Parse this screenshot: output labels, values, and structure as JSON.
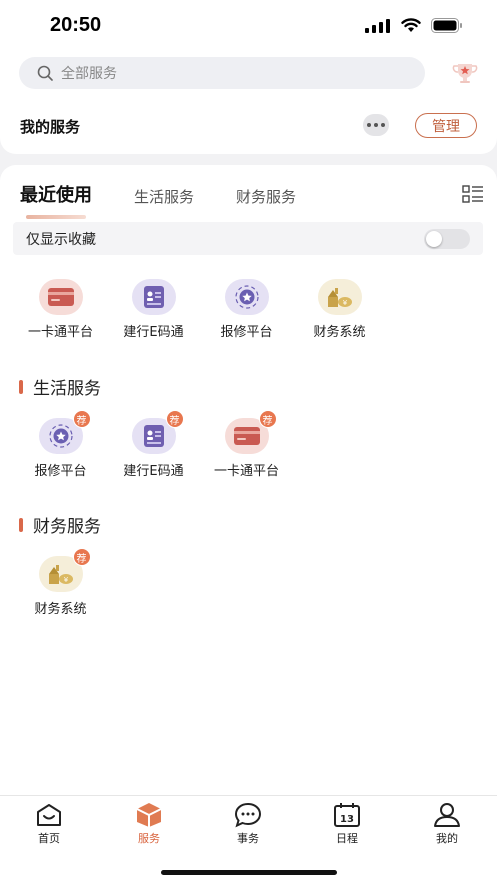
{
  "status": {
    "time": "20:50"
  },
  "search": {
    "placeholder": "全部服务"
  },
  "my_service": {
    "title": "我的服务",
    "manage_label": "管理"
  },
  "tabs": [
    "最近使用",
    "生活服务",
    "财务服务"
  ],
  "favorites": {
    "label": "仅显示收藏",
    "enabled": false
  },
  "recent_apps": [
    {
      "label": "一卡通平台",
      "icon": "card-icon"
    },
    {
      "label": "建行E码通",
      "icon": "id-card-icon"
    },
    {
      "label": "报修平台",
      "icon": "repair-icon"
    },
    {
      "label": "财务系统",
      "icon": "finance-icon"
    }
  ],
  "life_section": {
    "title": "生活服务",
    "badge": "荐",
    "apps": [
      {
        "label": "报修平台",
        "icon": "repair-icon"
      },
      {
        "label": "建行E码通",
        "icon": "id-card-icon"
      },
      {
        "label": "一卡通平台",
        "icon": "card-icon"
      }
    ]
  },
  "finance_section": {
    "title": "财务服务",
    "badge": "荐",
    "apps": [
      {
        "label": "财务系统",
        "icon": "finance-icon"
      }
    ]
  },
  "tabbar": [
    {
      "label": "首页",
      "icon": "home-icon"
    },
    {
      "label": "服务",
      "icon": "service-cube-icon",
      "active": true
    },
    {
      "label": "事务",
      "icon": "chat-icon"
    },
    {
      "label": "日程",
      "icon": "calendar-icon",
      "day": "13"
    },
    {
      "label": "我的",
      "icon": "user-icon"
    }
  ],
  "colors": {
    "accent": "#d8633d",
    "card_red": "#c95a52",
    "id_purple": "#6f5fb0",
    "repair_purple": "#6a5fb2",
    "finance_gold": "#c9a34a"
  }
}
